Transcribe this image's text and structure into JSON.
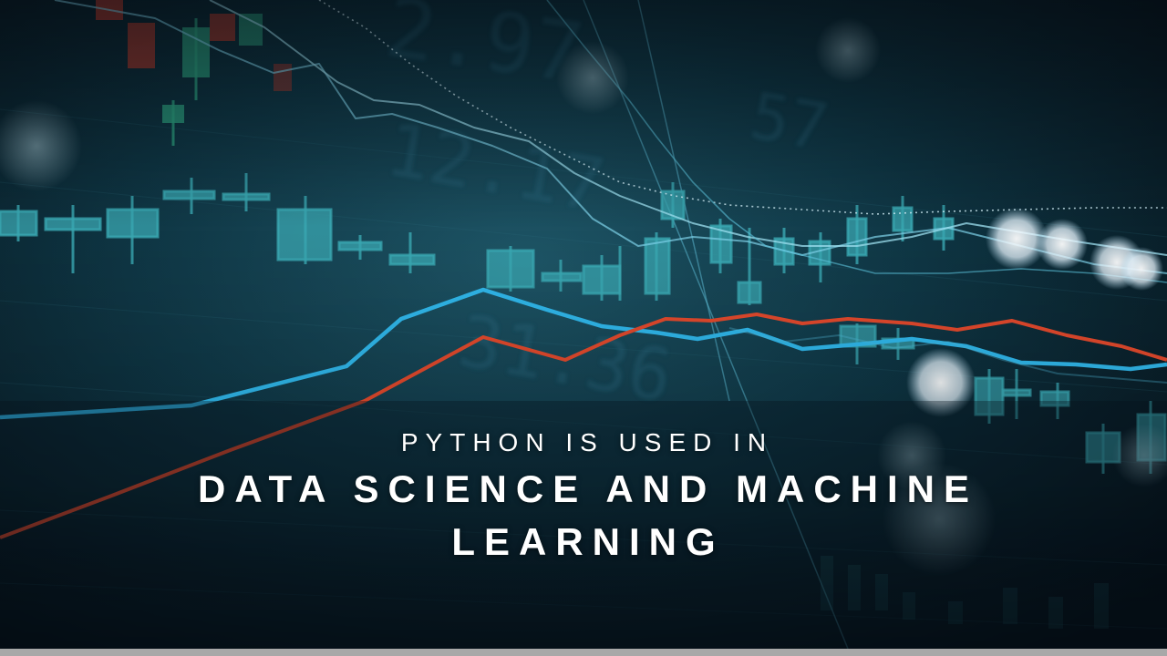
{
  "slide": {
    "subtitle": "PYTHON IS USED IN",
    "title_line1": "DATA SCIENCE AND MACHINE",
    "title_line2": "LEARNING"
  },
  "background": {
    "description_icon": "financial-chart-background",
    "accent_blue": "#2fb5e8",
    "accent_red": "#e0482b"
  }
}
